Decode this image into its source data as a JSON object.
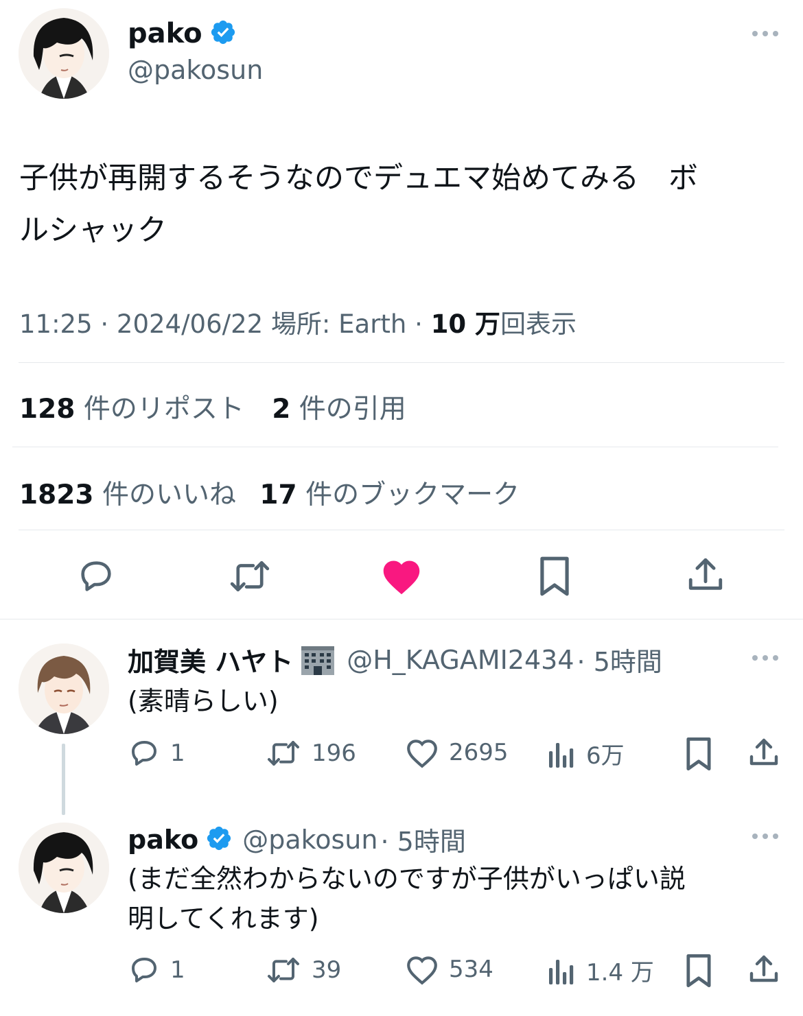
{
  "main_tweet": {
    "display_name": "pako",
    "handle": "@pakosun",
    "text_line1": "子供が再開するそうなのでデュエマ始めてみる　ボ",
    "text_line2": "ルシャック",
    "time": "11:25 · 2024/06/22 ",
    "location_label": "場所: Earth",
    "sep": " · ",
    "views_num": "10 万",
    "views_label": "回表示",
    "reposts_num": "128",
    "reposts_label": "件のリポスト",
    "quotes_num": "2",
    "quotes_label": "件の引用",
    "likes_num": "1823",
    "likes_label": "件のいいね",
    "bookmarks_num": "17",
    "bookmarks_label": "件のブックマーク"
  },
  "replies": [
    {
      "display_name": "加賀美 ハヤト",
      "badge_icon": "office-building-icon",
      "handle": "@H_KAGAMI2434",
      "time": "· 5時間",
      "text_line1": "(素晴らしい)",
      "text_line2": "",
      "reply_count": "1",
      "repost_count": "196",
      "like_count": "2695",
      "view_count": "6万"
    },
    {
      "display_name": "pako",
      "handle": "@pakosun",
      "time": "· 5時間",
      "text_line1": "(まだ全然わからないのですが子供がいっぱい説",
      "text_line2": "明してくれます)",
      "reply_count": "1",
      "repost_count": "39",
      "like_count": "534",
      "view_count": "1.4 万"
    }
  ],
  "colors": {
    "verified_blue": "#1d9bf0",
    "like_pink": "#f91880",
    "muted_text": "#536471",
    "divider": "#e6e9ec"
  }
}
